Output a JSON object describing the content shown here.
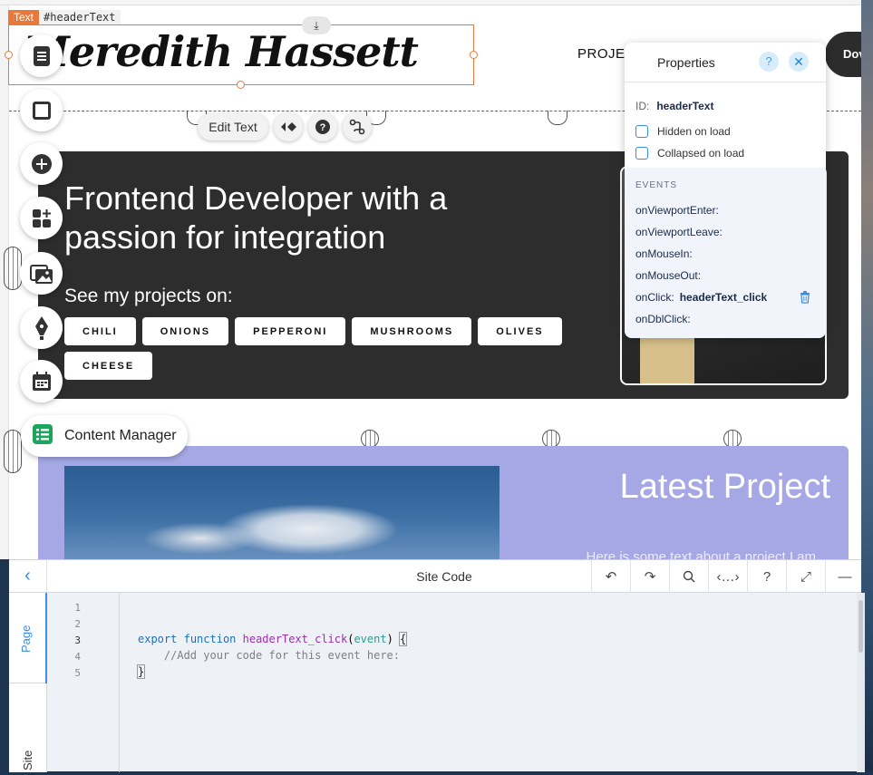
{
  "selection": {
    "tag_type": "Text",
    "tag_id": "#headerText"
  },
  "header": {
    "name": "Meredith Hassett",
    "nav_projects": "PROJEC",
    "download_label": "Dov"
  },
  "floating_actions": {
    "edit_text": "Edit Text"
  },
  "hero": {
    "title": "Frontend Developer with a passion for integration",
    "subtitle": "See my projects on:",
    "tags": [
      "CHILI",
      "ONIONS",
      "PEPPERONI",
      "MUSHROOMS",
      "OLIVES",
      "CHEESE"
    ]
  },
  "latest": {
    "title": "Latest Project",
    "text": "Here is some text about a project I am"
  },
  "toolbar": {
    "content_manager": "Content Manager"
  },
  "properties": {
    "title": "Properties",
    "id_label": "ID:",
    "id_value": "headerText",
    "hidden_on_load": "Hidden on load",
    "collapsed_on_load": "Collapsed on load",
    "events_label": "EVENTS",
    "events": [
      {
        "name": "onViewportEnter:",
        "handler": ""
      },
      {
        "name": "onViewportLeave:",
        "handler": ""
      },
      {
        "name": "onMouseIn:",
        "handler": ""
      },
      {
        "name": "onMouseOut:",
        "handler": ""
      },
      {
        "name": "onClick:",
        "handler": "headerText_click"
      },
      {
        "name": "onDblClick:",
        "handler": ""
      }
    ]
  },
  "code_panel": {
    "title": "Site Code",
    "tabs": {
      "page": "Page",
      "site": "Site"
    },
    "line_numbers": [
      "1",
      "2",
      "3",
      "4",
      "5"
    ],
    "code": {
      "export_kw": "export",
      "function_kw": "function",
      "fn_name": "headerText_click",
      "param": "event",
      "comment": "//Add your code for this event here:"
    }
  },
  "colors": {
    "accent": "#3a8ee6",
    "selection": "#e8793a",
    "hero_bg": "#2d2d2d",
    "latest_bg": "#a5a8e5"
  }
}
